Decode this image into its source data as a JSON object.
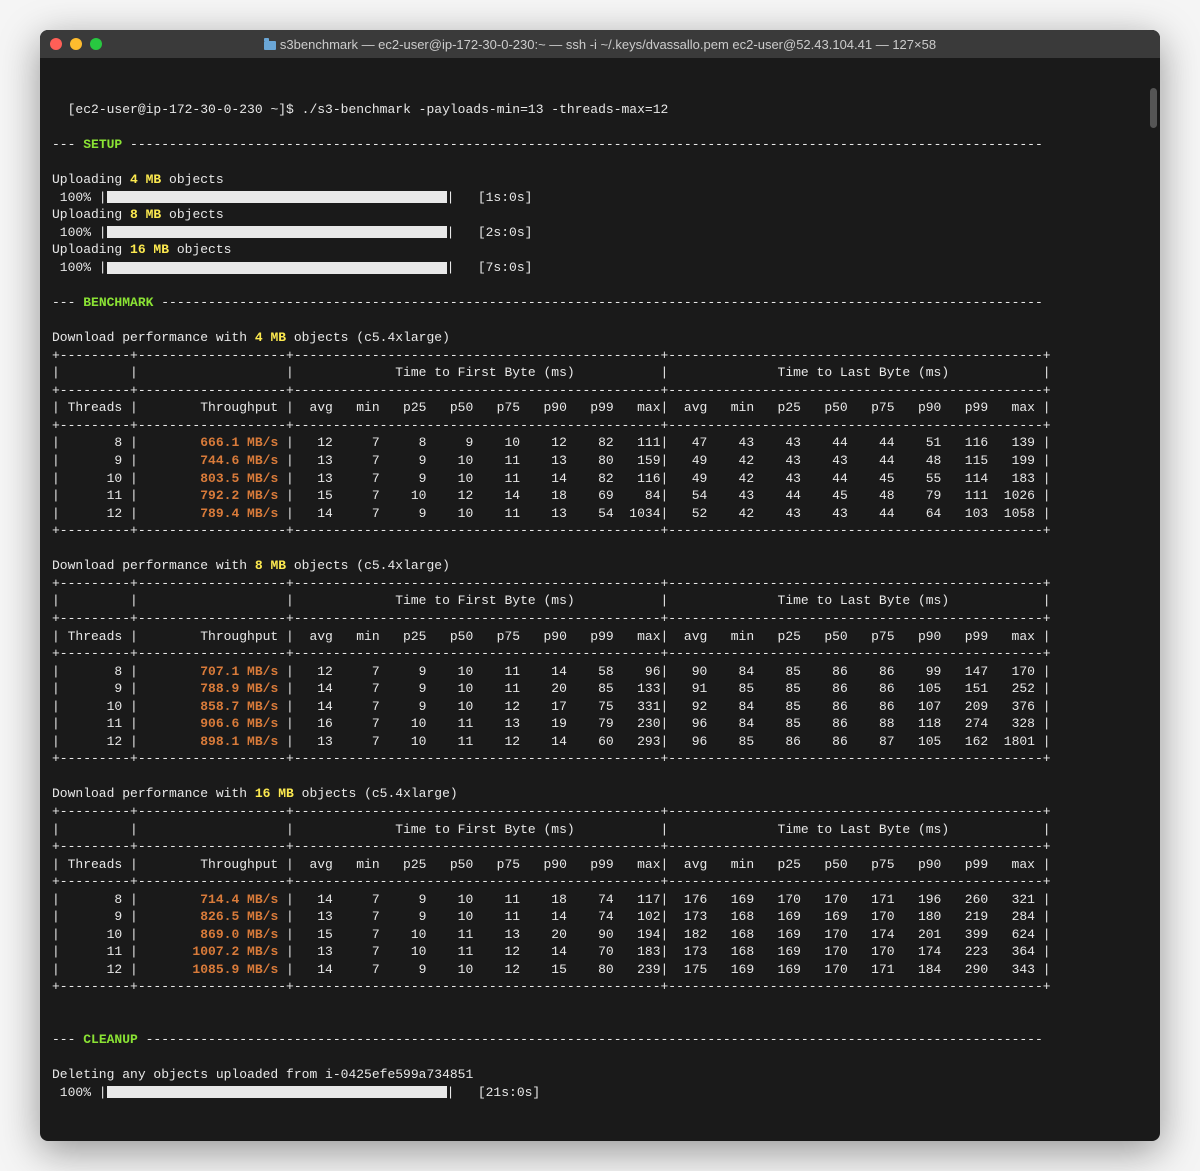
{
  "title": "s3benchmark — ec2-user@ip-172-30-0-230:~ — ssh -i ~/.keys/dvassallo.pem ec2-user@52.43.104.41 — 127×58",
  "prompt": "[ec2-user@ip-172-30-0-230 ~]$ ",
  "command": "./s3-benchmark -payloads-min=13 -threads-max=12",
  "sections": {
    "setup": "SETUP",
    "benchmark": "BENCHMARK",
    "cleanup": "CLEANUP"
  },
  "uploads": [
    {
      "size": "4 MB",
      "label": "objects",
      "pct": "100%",
      "time": "[1s:0s]"
    },
    {
      "size": "8 MB",
      "label": "objects",
      "pct": "100%",
      "time": "[2s:0s]"
    },
    {
      "size": "16 MB",
      "label": "objects",
      "pct": "100%",
      "time": "[7s:0s]"
    }
  ],
  "instance": "(c5.4xlarge)",
  "table_headers": {
    "ttfb": "Time to First Byte (ms)",
    "ttlb": "Time to Last Byte (ms)",
    "threads": "Threads",
    "throughput": "Throughput",
    "cols": [
      "avg",
      "min",
      "p25",
      "p50",
      "p75",
      "p90",
      "p99",
      "max"
    ]
  },
  "benchmarks": [
    {
      "size": "4 MB",
      "rows": [
        {
          "t": 8,
          "tp": "666.1 MB/s",
          "f": [
            12,
            7,
            8,
            9,
            10,
            12,
            82,
            111
          ],
          "l": [
            47,
            43,
            43,
            44,
            44,
            51,
            116,
            139
          ]
        },
        {
          "t": 9,
          "tp": "744.6 MB/s",
          "f": [
            13,
            7,
            9,
            10,
            11,
            13,
            80,
            159
          ],
          "l": [
            49,
            42,
            43,
            43,
            44,
            48,
            115,
            199
          ]
        },
        {
          "t": 10,
          "tp": "803.5 MB/s",
          "f": [
            13,
            7,
            9,
            10,
            11,
            14,
            82,
            116
          ],
          "l": [
            49,
            42,
            43,
            44,
            45,
            55,
            114,
            183
          ]
        },
        {
          "t": 11,
          "tp": "792.2 MB/s",
          "f": [
            15,
            7,
            10,
            12,
            14,
            18,
            69,
            84
          ],
          "l": [
            54,
            43,
            44,
            45,
            48,
            79,
            111,
            1026
          ]
        },
        {
          "t": 12,
          "tp": "789.4 MB/s",
          "f": [
            14,
            7,
            9,
            10,
            11,
            13,
            54,
            1034
          ],
          "l": [
            52,
            42,
            43,
            43,
            44,
            64,
            103,
            1058
          ]
        }
      ]
    },
    {
      "size": "8 MB",
      "rows": [
        {
          "t": 8,
          "tp": "707.1 MB/s",
          "f": [
            12,
            7,
            9,
            10,
            11,
            14,
            58,
            96
          ],
          "l": [
            90,
            84,
            85,
            86,
            86,
            99,
            147,
            170
          ]
        },
        {
          "t": 9,
          "tp": "788.9 MB/s",
          "f": [
            14,
            7,
            9,
            10,
            11,
            20,
            85,
            133
          ],
          "l": [
            91,
            85,
            85,
            86,
            86,
            105,
            151,
            252
          ]
        },
        {
          "t": 10,
          "tp": "858.7 MB/s",
          "f": [
            14,
            7,
            9,
            10,
            12,
            17,
            75,
            331
          ],
          "l": [
            92,
            84,
            85,
            86,
            86,
            107,
            209,
            376
          ]
        },
        {
          "t": 11,
          "tp": "906.6 MB/s",
          "f": [
            16,
            7,
            10,
            11,
            13,
            19,
            79,
            230
          ],
          "l": [
            96,
            84,
            85,
            86,
            88,
            118,
            274,
            328
          ]
        },
        {
          "t": 12,
          "tp": "898.1 MB/s",
          "f": [
            13,
            7,
            10,
            11,
            12,
            14,
            60,
            293
          ],
          "l": [
            96,
            85,
            86,
            86,
            87,
            105,
            162,
            1801
          ]
        }
      ]
    },
    {
      "size": "16 MB",
      "rows": [
        {
          "t": 8,
          "tp": "714.4 MB/s",
          "f": [
            14,
            7,
            9,
            10,
            11,
            18,
            74,
            117
          ],
          "l": [
            176,
            169,
            170,
            170,
            171,
            196,
            260,
            321
          ]
        },
        {
          "t": 9,
          "tp": "826.5 MB/s",
          "f": [
            13,
            7,
            9,
            10,
            11,
            14,
            74,
            102
          ],
          "l": [
            173,
            168,
            169,
            169,
            170,
            180,
            219,
            284
          ]
        },
        {
          "t": 10,
          "tp": "869.0 MB/s",
          "f": [
            15,
            7,
            10,
            11,
            13,
            20,
            90,
            194
          ],
          "l": [
            182,
            168,
            169,
            170,
            174,
            201,
            399,
            624
          ]
        },
        {
          "t": 11,
          "tp": "1007.2 MB/s",
          "f": [
            13,
            7,
            10,
            11,
            12,
            14,
            70,
            183
          ],
          "l": [
            173,
            168,
            169,
            170,
            170,
            174,
            223,
            364
          ]
        },
        {
          "t": 12,
          "tp": "1085.9 MB/s",
          "f": [
            14,
            7,
            9,
            10,
            12,
            15,
            80,
            239
          ],
          "l": [
            175,
            169,
            169,
            170,
            171,
            184,
            290,
            343
          ]
        }
      ]
    }
  ],
  "cleanup": {
    "text": "Deleting any objects uploaded from i-0425efe599a734851",
    "pct": "100%",
    "time": "[21s:0s]"
  }
}
